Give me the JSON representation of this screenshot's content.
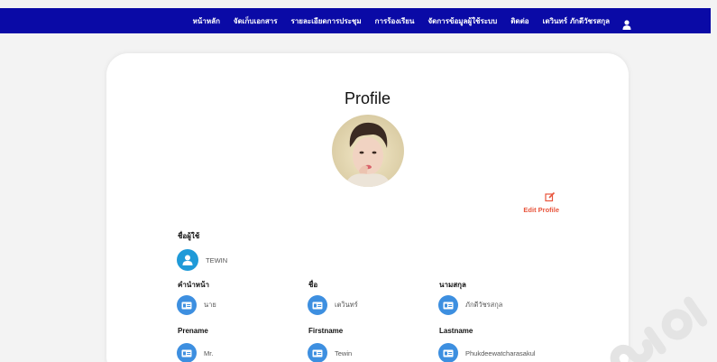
{
  "nav": {
    "items": [
      "หน้าหลัก",
      "จัดเก็บเอกสาร",
      "รายละเอียดการประชุม",
      "การร้องเรียน",
      "จัดการข้อมูลผู้ใช้ระบบ",
      "ติดต่อ",
      "เตวินทร์ ภักดีวัชรสกุล"
    ],
    "user_icon": "user-icon"
  },
  "profile": {
    "title": "Profile",
    "edit_label": "Edit Profile",
    "username_label": "ชื่อผู้ใช้",
    "username": "TEWIN",
    "fields_th": [
      {
        "label": "คำนำหน้า",
        "value": "นาย"
      },
      {
        "label": "ชื่อ",
        "value": "เตวินทร์"
      },
      {
        "label": "นามสกุล",
        "value": "ภักดีวัชรสกุล"
      }
    ],
    "fields_en": [
      {
        "label": "Prename",
        "value": "Mr."
      },
      {
        "label": "Firstname",
        "value": "Tewin"
      },
      {
        "label": "Lastname",
        "value": "Phukdeewatcharasakul"
      }
    ]
  },
  "colors": {
    "navbar": "#0a0aa6",
    "accent": "#e8553c",
    "icon_bg": "#3d8fe0"
  }
}
